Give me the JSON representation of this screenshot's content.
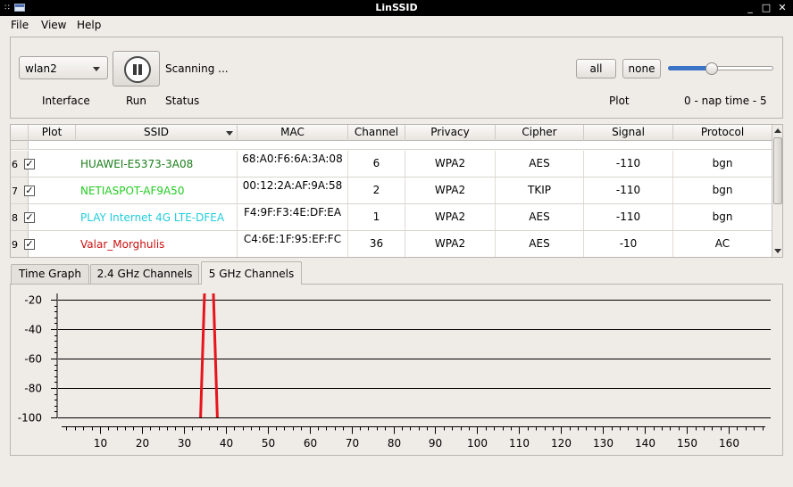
{
  "window": {
    "title": "LinSSID"
  },
  "menu": [
    "File",
    "View",
    "Help"
  ],
  "controls": {
    "interface_value": "wlan2",
    "interface_label": "Interface",
    "run_label": "Run",
    "status_value": "Scanning ...",
    "status_label": "Status",
    "plot_all": "all",
    "plot_none": "none",
    "plot_label": "Plot",
    "nap_label": "0 - nap time - 5",
    "nap_level": 0.4
  },
  "table": {
    "columns": [
      "Plot",
      "SSID",
      "MAC",
      "Channel",
      "Privacy",
      "Cipher",
      "Signal",
      "Protocol"
    ],
    "rows": [
      {
        "num": "6",
        "plot": true,
        "ssid": "HUAWEI-E5373-3A08",
        "ssid_color": "#1a7f1a",
        "mac": "68:A0:F6:6A:3A:08",
        "channel": "6",
        "privacy": "WPA2",
        "cipher": "AES",
        "signal": "-110",
        "protocol": "bgn"
      },
      {
        "num": "7",
        "plot": true,
        "ssid": "NETIASPOT-AF9A50",
        "ssid_color": "#22cc22",
        "mac": "00:12:2A:AF:9A:58",
        "channel": "2",
        "privacy": "WPA2",
        "cipher": "TKIP",
        "signal": "-110",
        "protocol": "bgn"
      },
      {
        "num": "8",
        "plot": true,
        "ssid": "PLAY Internet 4G LTE-DFEA",
        "ssid_color": "#22ccdd",
        "mac": "F4:9F:F3:4E:DF:EA",
        "channel": "1",
        "privacy": "WPA2",
        "cipher": "AES",
        "signal": "-110",
        "protocol": "bgn"
      },
      {
        "num": "9",
        "plot": true,
        "ssid": "Valar_Morghulis",
        "ssid_color": "#cc1111",
        "mac": "C4:6E:1F:95:EF:FC",
        "channel": "36",
        "privacy": "WPA2",
        "cipher": "AES",
        "signal": "-10",
        "protocol": "AC"
      }
    ]
  },
  "tabs": [
    "Time Graph",
    "2.4 GHz Channels",
    "5 GHz Channels"
  ],
  "active_tab": "5 GHz Channels",
  "chart_data": {
    "type": "line",
    "ylim": [
      -100,
      -20
    ],
    "yticks": [
      -20,
      -40,
      -60,
      -80,
      -100
    ],
    "xlim": [
      0,
      170
    ],
    "xticks": [
      10,
      20,
      30,
      40,
      50,
      60,
      70,
      80,
      90,
      100,
      110,
      120,
      130,
      140,
      150,
      160
    ],
    "grid": true,
    "series": [
      {
        "color": "#e8141b",
        "x": [
          34,
          35,
          37,
          38
        ],
        "y": [
          -100,
          -10,
          -10,
          -100
        ]
      }
    ]
  }
}
